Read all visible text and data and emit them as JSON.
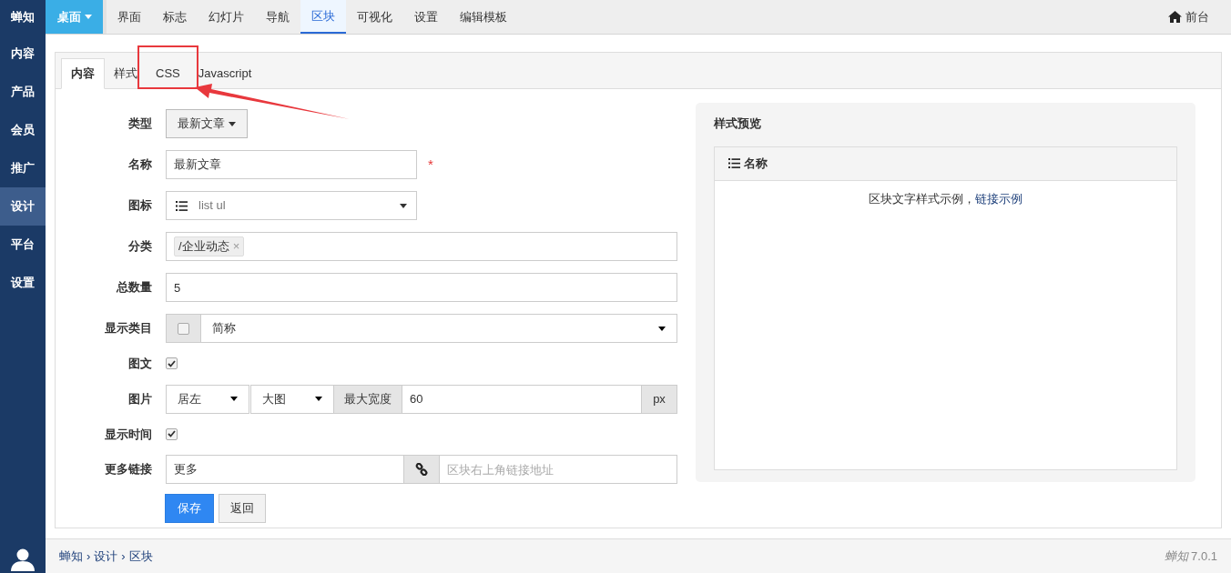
{
  "sidebar": {
    "brand": "蝉知",
    "items": [
      {
        "label": "内容",
        "selected": false
      },
      {
        "label": "产品",
        "selected": false
      },
      {
        "label": "会员",
        "selected": false
      },
      {
        "label": "推广",
        "selected": false
      },
      {
        "label": "设计",
        "selected": true
      },
      {
        "label": "平台",
        "selected": false
      },
      {
        "label": "设置",
        "selected": false
      }
    ]
  },
  "topnav": {
    "menu": {
      "label": "桌面"
    },
    "items": [
      {
        "label": "界面",
        "selected": false
      },
      {
        "label": "标志",
        "selected": false
      },
      {
        "label": "幻灯片",
        "selected": false
      },
      {
        "label": "导航",
        "selected": false
      },
      {
        "label": "区块",
        "selected": true
      },
      {
        "label": "可视化",
        "selected": false
      },
      {
        "label": "设置",
        "selected": false
      },
      {
        "label": "编辑模板",
        "selected": false
      }
    ],
    "frontend": "前台"
  },
  "tabs": [
    {
      "label": "内容",
      "selected": true,
      "highlighted": false
    },
    {
      "label": "样式",
      "selected": false,
      "highlighted": false
    },
    {
      "label": "CSS",
      "selected": false,
      "highlighted": true
    },
    {
      "label": "Javascript",
      "selected": false,
      "highlighted": false
    }
  ],
  "form": [
    {
      "label": "类型",
      "kind": "dropdown",
      "value": "最新文章"
    },
    {
      "label": "名称",
      "kind": "text",
      "value": "最新文章",
      "required_mark": "*"
    },
    {
      "label": "图标",
      "kind": "icon_select",
      "value": "list ul"
    },
    {
      "label": "分类",
      "kind": "tags",
      "tags": [
        {
          "label": "/企业动态",
          "remove": "×"
        }
      ]
    },
    {
      "label": "总数量",
      "kind": "text",
      "value": "5"
    },
    {
      "label": "显示类目",
      "kind": "check_select",
      "checked": false,
      "value": "简称"
    },
    {
      "label": "图文",
      "kind": "checkbox",
      "checked": true
    },
    {
      "label": "图片",
      "kind": "image",
      "align": "居左",
      "size": "大图",
      "addon": "最大宽度",
      "value": "60",
      "unit": "px"
    },
    {
      "label": "显示时间",
      "kind": "checkbox",
      "checked": true
    },
    {
      "label": "更多链接",
      "kind": "link",
      "value": "更多",
      "placeholder": "区块右上角链接地址"
    }
  ],
  "buttons": {
    "save": "保存",
    "back": "返回"
  },
  "preview": {
    "title": "样式预览",
    "block_title": "名称",
    "text": "区块文字样式示例，",
    "link": "链接示例"
  },
  "footer": {
    "breadcrumb": [
      "蝉知",
      "设计",
      "区块"
    ],
    "separator": "›",
    "version_logo": "蝉知",
    "version": "7.0.1"
  }
}
